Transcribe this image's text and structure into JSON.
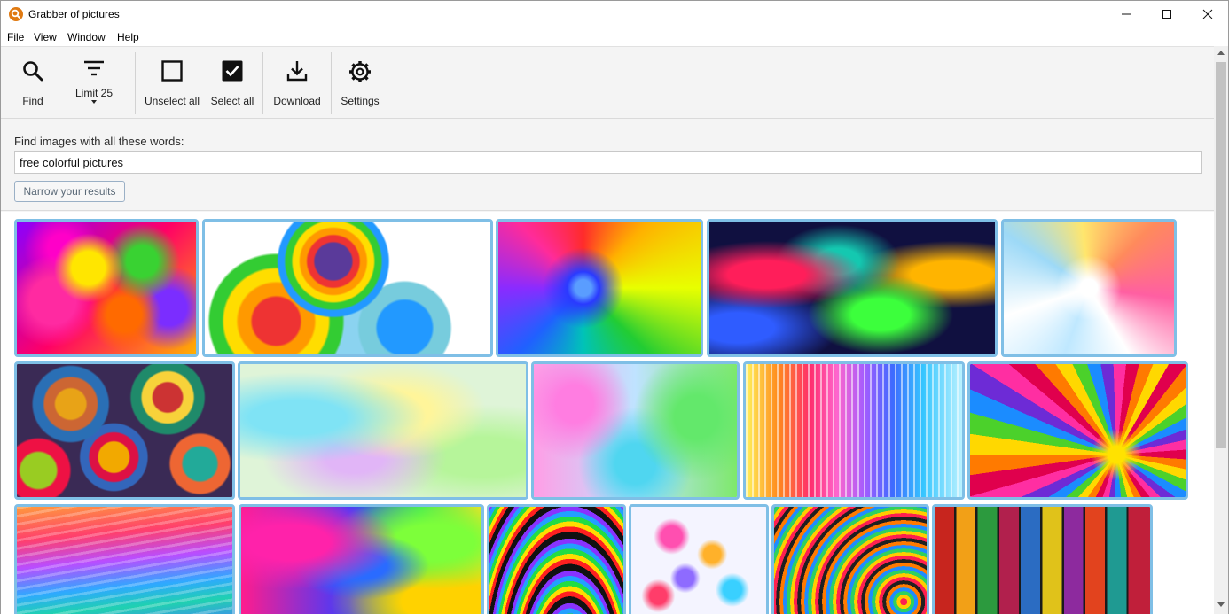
{
  "window": {
    "title": "Grabber of pictures"
  },
  "menu": {
    "items": [
      "File",
      "View",
      "Window",
      "Help"
    ]
  },
  "toolbar": {
    "find_label": "Find",
    "limit_label": "Limit 25",
    "unselect_all_label": "Unselect all",
    "select_all_label": "Select all",
    "download_label": "Download",
    "settings_label": "Settings"
  },
  "search": {
    "label": "Find images with all these words:",
    "value": "free colorful pictures",
    "narrow_button_label": "Narrow your results"
  },
  "colors": {
    "accent": "#7fbfe6",
    "selection_border": "#7fbfe6"
  },
  "results": {
    "all_selected": true,
    "thumbnails": [
      {
        "name": "paint-splash"
      },
      {
        "name": "rainbow-swirls-clipart"
      },
      {
        "name": "color-explosion-burst"
      },
      {
        "name": "colored-smoke"
      },
      {
        "name": "pastel-swirl"
      },
      {
        "name": "mandala-pattern"
      },
      {
        "name": "pastel-clouds"
      },
      {
        "name": "bokeh-hexagons"
      },
      {
        "name": "rainbow-vertical-lines"
      },
      {
        "name": "rainbow-spiral"
      },
      {
        "name": "rainbow-waves"
      },
      {
        "name": "abstract-paint-texture"
      },
      {
        "name": "neon-stripes"
      },
      {
        "name": "floating-cubes"
      },
      {
        "name": "colorful-bracelets"
      },
      {
        "name": "painted-wood-planks"
      }
    ]
  }
}
